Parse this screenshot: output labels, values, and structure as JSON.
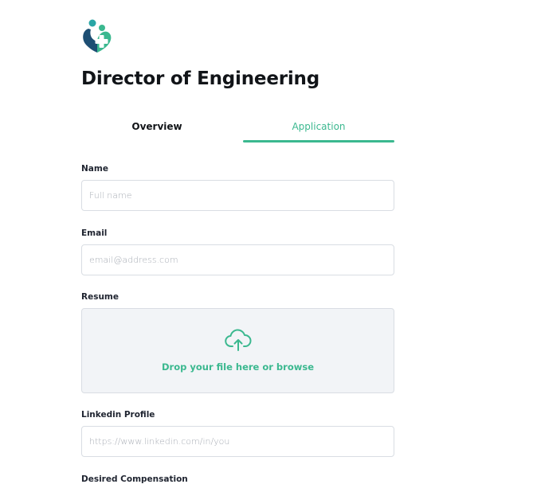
{
  "job": {
    "title": "Director of Engineering"
  },
  "tabs": {
    "overview": "Overview",
    "application": "Application"
  },
  "form": {
    "name": {
      "label": "Name",
      "placeholder": "Full name"
    },
    "email": {
      "label": "Email",
      "placeholder": "email@address.com"
    },
    "resume": {
      "label": "Resume",
      "drop_text": "Drop your file here or browse",
      "icon": "cloud-upload-icon"
    },
    "linkedin": {
      "label": "Linkedin Profile",
      "placeholder": "https://www.linkedin.com/in/you"
    },
    "compensation": {
      "label": "Desired Compensation"
    }
  },
  "colors": {
    "accent": "#3bb88f",
    "logo_teal": "#2aa6a6",
    "logo_navy": "#1d4e73"
  }
}
